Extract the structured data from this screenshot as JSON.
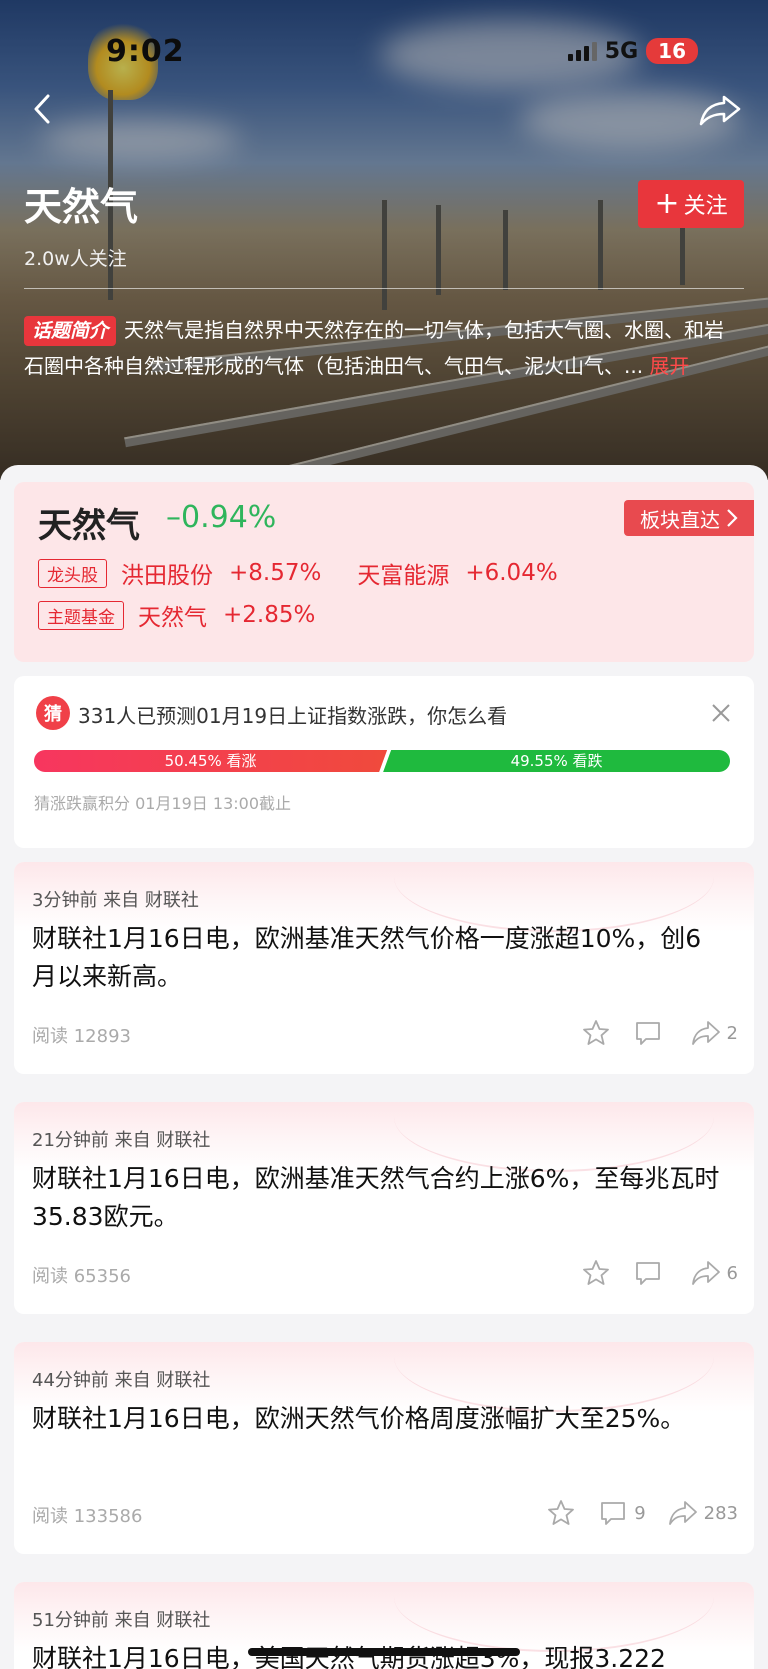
{
  "status_bar": {
    "time": "9:02",
    "network": "5G",
    "battery": "16"
  },
  "header": {
    "title": "天然气",
    "followers": "2.0w人关注",
    "follow_button": "关注",
    "intro_tag": "话题简介",
    "intro_text": "天然气是指自然界中天然存在的一切气体，包括大气圈、水圈、和岩石圈中各种自然过程形成的气体（包括油田气、气田气、泥火山气、...",
    "intro_more": "展开"
  },
  "sector": {
    "name": "天然气",
    "change": "–0.94%",
    "direct_label": "板块直达",
    "leader_badge": "龙头股",
    "leaders": [
      {
        "name": "洪田股份",
        "change": "+8.57%"
      },
      {
        "name": "天富能源",
        "change": "+6.04%"
      }
    ],
    "fund_badge": "主题基金",
    "fund": {
      "name": "天然气",
      "change": "+2.85%"
    }
  },
  "prediction": {
    "icon": "猜",
    "question": "331人已预测01月19日上证指数涨跌，你怎么看",
    "up_label": "50.45% 看涨",
    "up_ratio": 0.5045,
    "down_label": "49.55% 看跌",
    "note": "猜涨跌赢积分   01月19日 13:00截止"
  },
  "news": [
    {
      "meta": "3分钟前 来自 财联社",
      "body": "财联社1月16日电，欧洲基准天然气价格一度涨超10%，创6月以来新高。",
      "reads": "阅读 12893",
      "comments": "",
      "shares": "2"
    },
    {
      "meta": "21分钟前 来自 财联社",
      "body": "财联社1月16日电，欧洲基准天然气合约上涨6%，至每兆瓦时35.83欧元。",
      "reads": "阅读 65356",
      "comments": "",
      "shares": "6"
    },
    {
      "meta": "44分钟前 来自 财联社",
      "body": "财联社1月16日电，欧洲天然气价格周度涨幅扩大至25%。",
      "reads": "阅读 133586",
      "comments": "9",
      "shares": "283"
    },
    {
      "meta": "51分钟前 来自 财联社",
      "body": "财联社1月16日电，美国天然气期货涨超3%，现报3.222",
      "reads": "",
      "comments": "",
      "shares": ""
    }
  ]
}
